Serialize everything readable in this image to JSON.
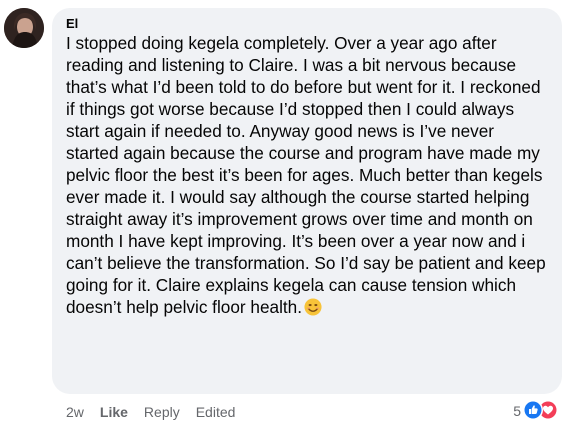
{
  "comment": {
    "author": "El",
    "text": "I stopped doing kegela completely. Over a year ago after reading and listening to Claire. I was a bit nervous because that’s what I’d been told to do before but went for it. I reckoned if things got worse because I’d stopped then I could always start again if needed to. Anyway good news is I’ve never started again because the course and program have made my pelvic floor the best it’s been for ages. Much better than kegels ever made it. I would say although the course started helping straight away it’s improvement grows over time and month on month I have kept improving. It’s been over a year now and i can’t believe the transformation. So I’d say be patient and keep going for it. Claire explains kegela can cause tension which doesn’t help pelvic floor health.",
    "emoji": "smiling-face-emoji"
  },
  "actions": {
    "time": "2w",
    "like": "Like",
    "reply": "Reply",
    "edited": "Edited"
  },
  "reactions": {
    "count": "5",
    "icons": [
      "like-reaction-icon",
      "love-reaction-icon"
    ],
    "like_color": "#1877f2",
    "love_color": "#f33e58"
  }
}
